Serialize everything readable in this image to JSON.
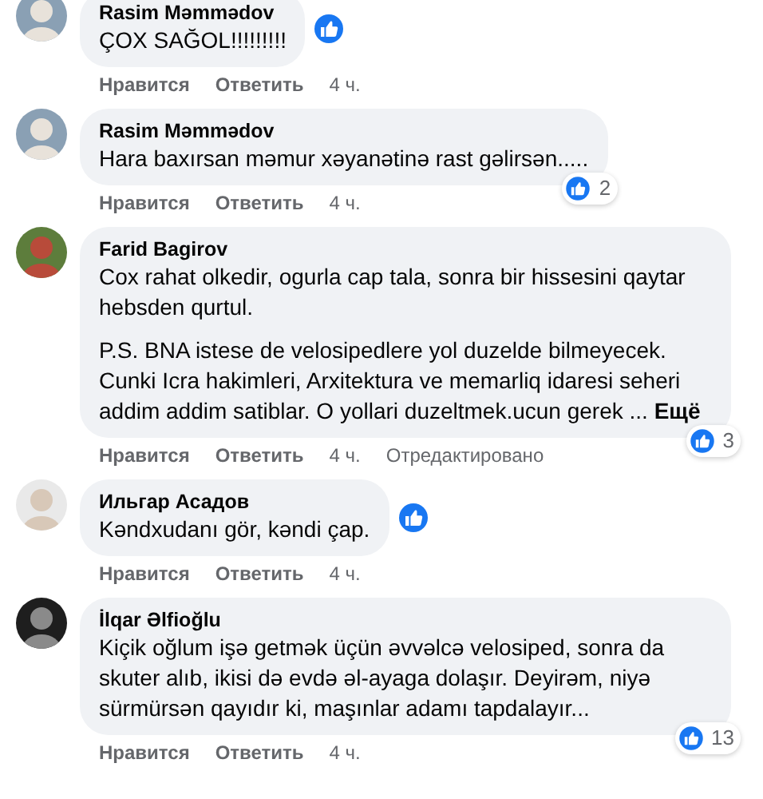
{
  "comments": [
    {
      "author": "Rasim Məmmədov",
      "paragraphs": [
        "ÇOX SAĞOL!!!!!!!!!"
      ],
      "reaction": {
        "kind": "inline"
      },
      "actions": {
        "like": "Нравится",
        "reply": "Ответить",
        "time": "4 ч."
      }
    },
    {
      "author": "Rasim Məmmədov",
      "paragraphs": [
        "Hara baxırsan məmur xəyanətinə rast gəlirsən....."
      ],
      "reaction": {
        "kind": "corner",
        "count": "2"
      },
      "actions": {
        "like": "Нравится",
        "reply": "Ответить",
        "time": "4 ч."
      }
    },
    {
      "author": "Farid Bagirov",
      "paragraphs": [
        "Cox rahat olkedir, ogurla cap tala, sonra bir hissesini qaytar hebsden qurtul.",
        "P.S. BNA istese de velosipedlere yol duzelde bilmeyecek. Cunki Icra hakimleri, Arxitektura ve memarliq idaresi seheri addim addim satiblar. O yollari duzeltmek.ucun gerek ... **Ещё**"
      ],
      "reaction": {
        "kind": "corner",
        "count": "3"
      },
      "actions": {
        "like": "Нравится",
        "reply": "Ответить",
        "time": "4 ч.",
        "edited": "Отредактировано"
      }
    },
    {
      "author": "Ильгар Асадов",
      "paragraphs": [
        "Kəndxudanı gör, kəndi çap."
      ],
      "reaction": {
        "kind": "inline"
      },
      "actions": {
        "like": "Нравится",
        "reply": "Ответить",
        "time": "4 ч."
      }
    },
    {
      "author": "İlqar Əlfioğlu",
      "paragraphs": [
        "Kiçik oğlum işə getmək üçün əvvəlcə velosiped, sonra da skuter alıb, ikisi də evdə əl-ayaga dolaşır. Deyirəm, niyə sürmürsən qayıdır ki, maşınlar adamı tapdalayır..."
      ],
      "reaction": {
        "kind": "corner",
        "count": "13"
      },
      "actions": {
        "like": "Нравится",
        "reply": "Ответить",
        "time": "4 ч."
      }
    }
  ]
}
